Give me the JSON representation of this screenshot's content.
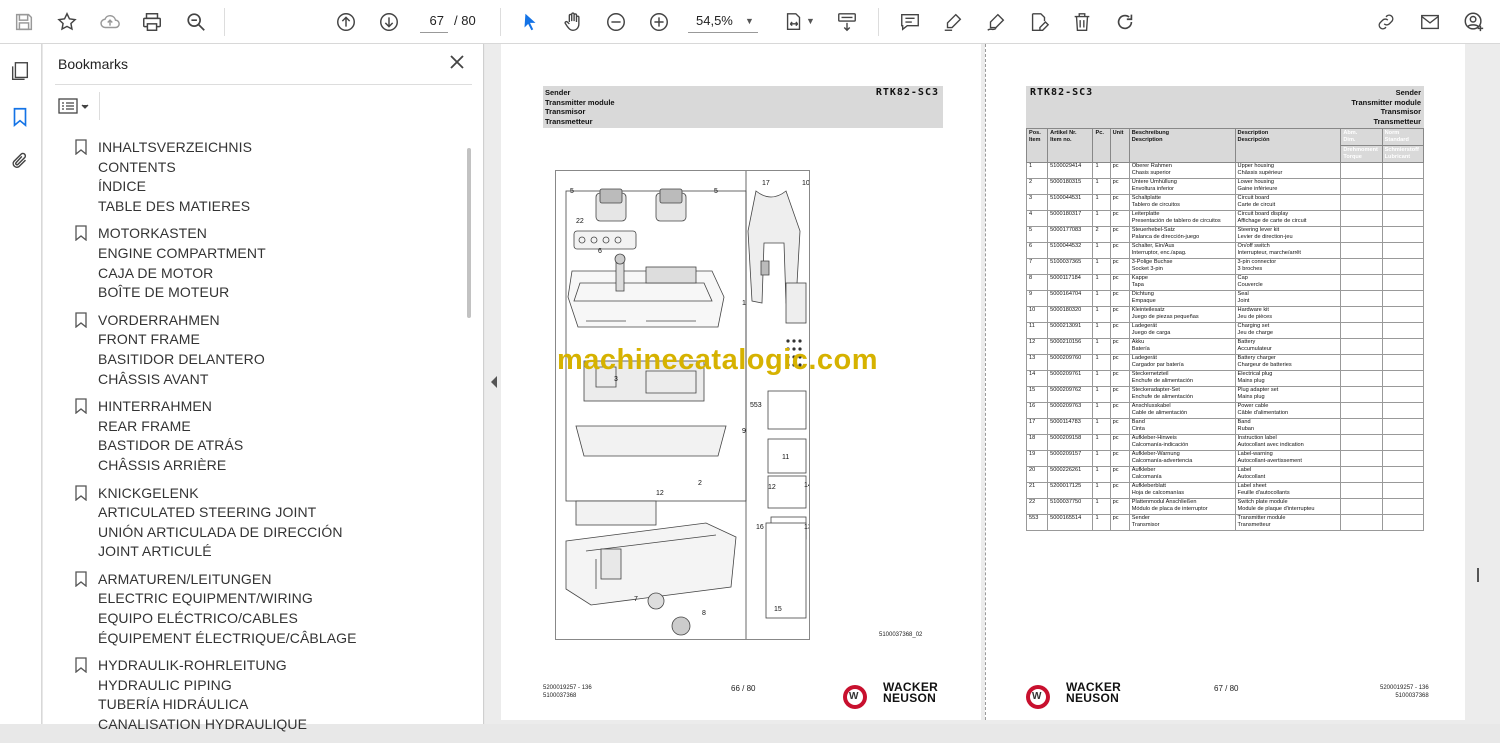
{
  "toolbar": {
    "page_current": "67",
    "page_total": "/ 80",
    "zoom": "54,5%"
  },
  "bookmarks": {
    "title": "Bookmarks",
    "groups": [
      {
        "lines": [
          "INHALTSVERZEICHNIS",
          "CONTENTS",
          "ÍNDICE",
          "TABLE DES MATIERES"
        ]
      },
      {
        "lines": [
          "MOTORKASTEN",
          "ENGINE COMPARTMENT",
          "CAJA DE MOTOR",
          "BOÎTE DE MOTEUR"
        ]
      },
      {
        "lines": [
          "VORDERRAHMEN",
          "FRONT FRAME",
          "BASITIDOR DELANTERO",
          "CHÂSSIS AVANT"
        ]
      },
      {
        "lines": [
          "HINTERRAHMEN",
          "REAR FRAME",
          "BASTIDOR DE ATRÁS",
          "CHÂSSIS ARRIÈRE"
        ]
      },
      {
        "lines": [
          "KNICKGELENK",
          "ARTICULATED STEERING JOINT",
          "UNIÓN ARTICULADA DE DIRECCIÓN",
          "JOINT ARTICULÉ"
        ]
      },
      {
        "lines": [
          "ARMATUREN/LEITUNGEN",
          "ELECTRIC EQUIPMENT/WIRING",
          "EQUIPO ELÉCTRICO/CABLES",
          "ÉQUIPEMENT ÉLECTRIQUE/CÂBLAGE"
        ]
      },
      {
        "lines": [
          "HYDRAULIK-ROHRLEITUNG",
          "HYDRAULIC PIPING",
          "TUBERÍA HIDRÁULICA",
          "CANALISATION HYDRAULIQUE"
        ]
      }
    ]
  },
  "left_page": {
    "header_lines": [
      "Sender",
      "Transmitter module",
      "Transmisor",
      "Transmetteur"
    ],
    "model": "RTK82-SC3",
    "drawing_ref": "5100037368_02",
    "callouts": [
      "5",
      "5",
      "17",
      "10",
      "22",
      "6",
      "1",
      "21",
      "20",
      "553",
      "19",
      "9",
      "18",
      "11",
      "12",
      "2",
      "14",
      "16",
      "13",
      "12",
      "7",
      "8",
      "15",
      "3"
    ],
    "watermark": "machinecatalogic.com",
    "footer_left": [
      "5200019257 - 136",
      "5100037368"
    ],
    "page_label": "66 / 80",
    "brand": [
      "WACKER",
      "NEUSON"
    ]
  },
  "right_page": {
    "model": "RTK82-SC3",
    "header_lines": [
      "Sender",
      "Transmitter module",
      "Transmisor",
      "Transmetteur"
    ],
    "table_headers": {
      "pos": [
        "Pos.",
        "Item"
      ],
      "article": [
        "Artikel Nr.",
        "Item no."
      ],
      "pc": "Pc.",
      "unit": "Unit",
      "desc": [
        "Beschreibung",
        "Description"
      ],
      "desc2": [
        "Description",
        "Descripción"
      ],
      "col7": [
        "Abm.",
        "Dim.",
        "Drehmoment",
        "Torque"
      ],
      "col8": [
        "Norm",
        "Standard",
        "Schmierstoff",
        "Lubricant"
      ]
    },
    "rows": [
      {
        "pos": "1",
        "article": "5100029414",
        "pc": "1",
        "unit": "pc",
        "d1": "Oberer Rahmen",
        "d1b": "Chasis superior",
        "d2": "Upper housing",
        "d2b": "Châssis supérieur"
      },
      {
        "pos": "2",
        "article": "5000180315",
        "pc": "1",
        "unit": "pc",
        "d1": "Untere Umhüllung",
        "d1b": "Envoltura inferior",
        "d2": "Lower housing",
        "d2b": "Gaine inférieure"
      },
      {
        "pos": "3",
        "article": "5100044531",
        "pc": "1",
        "unit": "pc",
        "d1": "Schaltplatte",
        "d1b": "Tablero de circuitos",
        "d2": "Circuit board",
        "d2b": "Carte de circuit"
      },
      {
        "pos": "4",
        "article": "5000180317",
        "pc": "1",
        "unit": "pc",
        "d1": "Leiterplatte",
        "d1b": "Presentación de tablero de circuitos",
        "d2": "Circuit board display",
        "d2b": "Affichage de carte de circuit"
      },
      {
        "pos": "5",
        "article": "5000177083",
        "pc": "2",
        "unit": "pc",
        "d1": "Steuerhebel-Satz",
        "d1b": "Palanca de dirección-juego",
        "d2": "Steering lever kit",
        "d2b": "Levier de direction-jeu"
      },
      {
        "pos": "6",
        "article": "5100044532",
        "pc": "1",
        "unit": "pc",
        "d1": "Schalter, Ein/Aus",
        "d1b": "Interruptor, enc./apag.",
        "d2": "On/off switch",
        "d2b": "Interrupteur, marche/arrêt"
      },
      {
        "pos": "7",
        "article": "5100037365",
        "pc": "1",
        "unit": "pc",
        "d1": "3-Polige Buchse",
        "d1b": "Socket 3-pin",
        "d2": "3-pin connector",
        "d2b": "3 broches"
      },
      {
        "pos": "8",
        "article": "5000117184",
        "pc": "1",
        "unit": "pc",
        "d1": "Kappe",
        "d1b": "Tapa",
        "d2": "Cap",
        "d2b": "Couvercle"
      },
      {
        "pos": "9",
        "article": "5000164704",
        "pc": "1",
        "unit": "pc",
        "d1": "Dichtung",
        "d1b": "Empaque",
        "d2": "Seal",
        "d2b": "Joint"
      },
      {
        "pos": "10",
        "article": "5000180320",
        "pc": "1",
        "unit": "pc",
        "d1": "Kleinteilesatz",
        "d1b": "Juego de piezas pequeñas",
        "d2": "Hardware kit",
        "d2b": "Jeu de pièces"
      },
      {
        "pos": "11",
        "article": "5000213091",
        "pc": "1",
        "unit": "pc",
        "d1": "Ladegerät",
        "d1b": "Juego de carga",
        "d2": "Charging set",
        "d2b": "Jeu de charge"
      },
      {
        "pos": "12",
        "article": "5000210156",
        "pc": "1",
        "unit": "pc",
        "d1": "Akku",
        "d1b": "Batería",
        "d2": "Battery",
        "d2b": "Accumulateur"
      },
      {
        "pos": "13",
        "article": "5000209760",
        "pc": "1",
        "unit": "pc",
        "d1": "Ladegerät",
        "d1b": "Cargador par batería",
        "d2": "Battery charger",
        "d2b": "Chargeur de batteries"
      },
      {
        "pos": "14",
        "article": "5000209761",
        "pc": "1",
        "unit": "pc",
        "d1": "Steckernetzteil",
        "d1b": "Enchufe de alimentación",
        "d2": "Electrical plug",
        "d2b": "Mains plug"
      },
      {
        "pos": "15",
        "article": "5000209762",
        "pc": "1",
        "unit": "pc",
        "d1": "Steckeradapter-Set",
        "d1b": "Enchufe de alimentación",
        "d2": "Plug adapter set",
        "d2b": "Mains plug"
      },
      {
        "pos": "16",
        "article": "5000209763",
        "pc": "1",
        "unit": "pc",
        "d1": "Anschlusskabel",
        "d1b": "Cable de alimentación",
        "d2": "Power cable",
        "d2b": "Câble d'alimentation"
      },
      {
        "pos": "17",
        "article": "5000114783",
        "pc": "1",
        "unit": "pc",
        "d1": "Band",
        "d1b": "Cinta",
        "d2": "Band",
        "d2b": "Ruban"
      },
      {
        "pos": "18",
        "article": "5000209158",
        "pc": "1",
        "unit": "pc",
        "d1": "Aufkleber-Hinweis",
        "d1b": "Calcomanía-indicación",
        "d2": "Instruction label",
        "d2b": "Autocollant avec indication"
      },
      {
        "pos": "19",
        "article": "5000209157",
        "pc": "1",
        "unit": "pc",
        "d1": "Aufkleber-Warnung",
        "d1b": "Calcomanía-advertencia",
        "d2": "Label-warning",
        "d2b": "Autocollant-avertissement"
      },
      {
        "pos": "20",
        "article": "5000226261",
        "pc": "1",
        "unit": "pc",
        "d1": "Aufkleber",
        "d1b": "Calcomanía",
        "d2": "Label",
        "d2b": "Autocollant"
      },
      {
        "pos": "21",
        "article": "5200017125",
        "pc": "1",
        "unit": "pc",
        "d1": "Aufkleberblatt",
        "d1b": "Hoja de calcomanías",
        "d2": "Label sheet",
        "d2b": "Feuille d'autocollants"
      },
      {
        "pos": "22",
        "article": "5100037750",
        "pc": "1",
        "unit": "pc",
        "d1": "Plattenmodul Anschließen",
        "d1b": "Módulo de placa de interruptor",
        "d2": "Switch plate module",
        "d2b": "Module de plaque d'interrupteu"
      },
      {
        "pos": "553",
        "article": "5000165514",
        "pc": "1",
        "unit": "pc",
        "d1": "Sender",
        "d1b": "Transmisor",
        "d2": "Transmitter module",
        "d2b": "Transmetteur"
      }
    ],
    "page_label": "67 / 80",
    "footer_right": [
      "5200019257 - 136",
      "5100037368"
    ],
    "brand": [
      "WACKER",
      "NEUSON"
    ]
  },
  "colors": {
    "watermark": "#d6b200",
    "header_bg": "#d9d9d9",
    "logo_red": "#c8102e"
  }
}
